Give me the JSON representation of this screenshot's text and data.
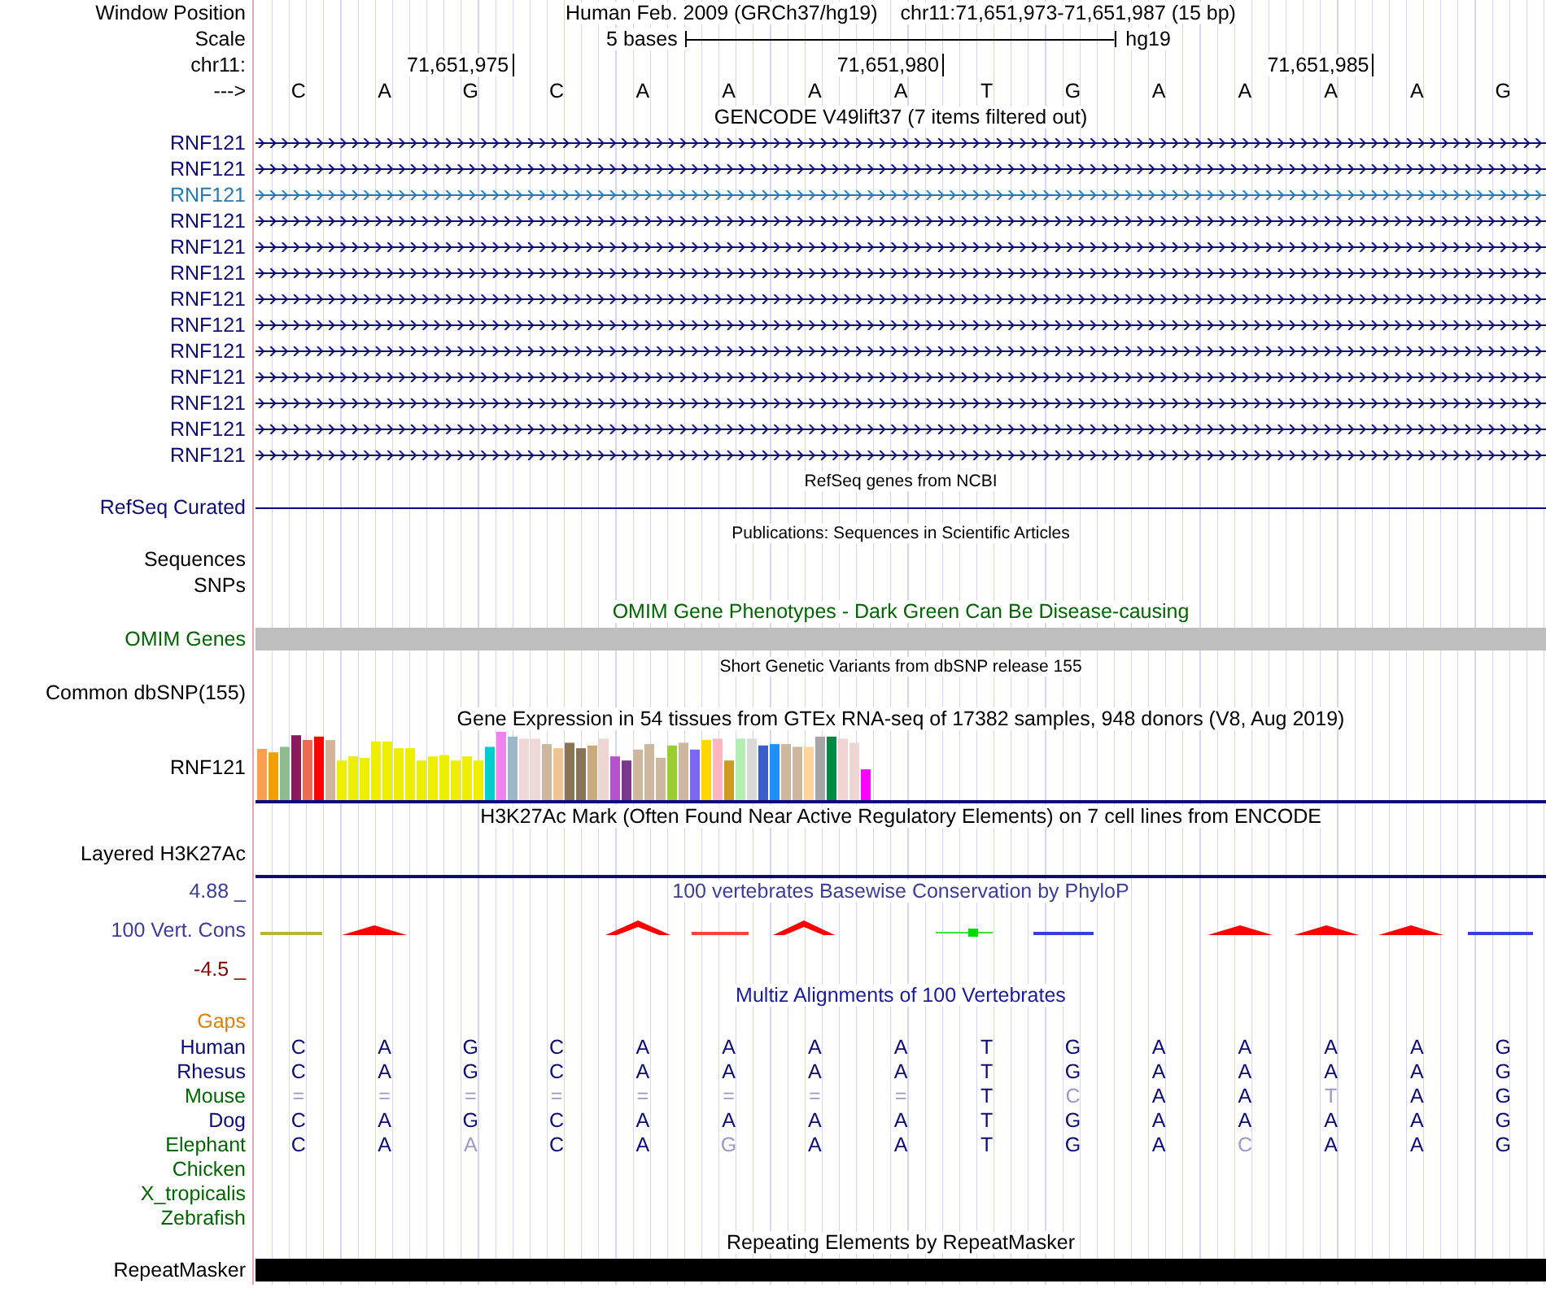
{
  "position": {
    "label": "Window Position",
    "assembly": "Human Feb. 2009 (GRCh37/hg19)",
    "range": "chr11:71,651,973-71,651,987 (15 bp)"
  },
  "scale": {
    "label": "Scale",
    "left": "5 bases",
    "right": "hg19"
  },
  "ruler": {
    "label": "chr11:",
    "ticks": [
      "71,651,975",
      "71,651,980",
      "71,651,985"
    ]
  },
  "bases": {
    "label": "--->",
    "letters": [
      "C",
      "A",
      "G",
      "C",
      "A",
      "A",
      "A",
      "A",
      "T",
      "G",
      "A",
      "A",
      "A",
      "A",
      "G"
    ]
  },
  "tracks": [
    {
      "kind": "genes",
      "title": "GENCODE V49lift37 (7 items filtered out)",
      "color": "#000000",
      "items": [
        {
          "name": "RNF121",
          "color": "#0c0c78"
        },
        {
          "name": "RNF121",
          "color": "#0c0c78"
        },
        {
          "name": "RNF121",
          "color": "#2878b4"
        },
        {
          "name": "RNF121",
          "color": "#0c0c78"
        },
        {
          "name": "RNF121",
          "color": "#0c0c78"
        },
        {
          "name": "RNF121",
          "color": "#0c0c78"
        },
        {
          "name": "RNF121",
          "color": "#0c0c78"
        },
        {
          "name": "RNF121",
          "color": "#0c0c78"
        },
        {
          "name": "RNF121",
          "color": "#0c0c78"
        },
        {
          "name": "RNF121",
          "color": "#0c0c78"
        },
        {
          "name": "RNF121",
          "color": "#0c0c78"
        },
        {
          "name": "RNF121",
          "color": "#0c0c78"
        },
        {
          "name": "RNF121",
          "color": "#0c0c78"
        }
      ]
    },
    {
      "kind": "line",
      "title": "RefSeq genes from NCBI",
      "label": "RefSeq Curated",
      "color": "#0c0c78"
    },
    {
      "kind": "labels",
      "title": "Publications: Sequences in Scientific Articles",
      "labels": [
        "Sequences",
        "SNPs"
      ],
      "color": "#000000"
    },
    {
      "kind": "phenotypes",
      "title": "OMIM Gene Phenotypes - Dark Green Can Be Disease-causing",
      "label": "OMIM Genes",
      "color": "#006400"
    },
    {
      "kind": "labels",
      "title": "Short Genetic Variants from dbSNP release 155",
      "labels": [
        "Common dbSNP(155)"
      ],
      "color": "#000000"
    },
    {
      "kind": "expression",
      "title": "Gene Expression in 54 tissues from GTEx RNA-seq of 17382 samples, 948 donors (V8, Aug 2019)",
      "label": "RNF121",
      "color": "#000000"
    },
    {
      "kind": "signal",
      "title": "H3K27Ac Mark (Often Found Near Active Regulatory Elements) on 7 cell lines from ENCODE",
      "label": "Layered H3K27Ac",
      "color": "#000000"
    },
    {
      "kind": "conservation",
      "title": "100 vertebrates Basewise Conservation by PhyloP",
      "label": "100 Vert. Cons",
      "max": "4.88 _",
      "min": "-4.5 _",
      "color": "#3c3c9a"
    },
    {
      "kind": "alignment",
      "title": "Multiz Alignments of 100 Vertebrates",
      "gaps": "Gaps",
      "color": "#1a1aa0",
      "species": [
        {
          "name": "Human",
          "color": "#0c0c78",
          "cells": [
            {
              "b": "C",
              "faded": false
            },
            {
              "b": "A",
              "faded": false
            },
            {
              "b": "G",
              "faded": false
            },
            {
              "b": "C",
              "faded": false
            },
            {
              "b": "A",
              "faded": false
            },
            {
              "b": "A",
              "faded": false
            },
            {
              "b": "A",
              "faded": false
            },
            {
              "b": "A",
              "faded": false
            },
            {
              "b": "T",
              "faded": false
            },
            {
              "b": "G",
              "faded": false
            },
            {
              "b": "A",
              "faded": false
            },
            {
              "b": "A",
              "faded": false
            },
            {
              "b": "A",
              "faded": false
            },
            {
              "b": "A",
              "faded": false
            },
            {
              "b": "G",
              "faded": false
            }
          ]
        },
        {
          "name": "Rhesus",
          "color": "#0c0c78",
          "cells": [
            {
              "b": "C",
              "faded": false
            },
            {
              "b": "A",
              "faded": false
            },
            {
              "b": "G",
              "faded": false
            },
            {
              "b": "C",
              "faded": false
            },
            {
              "b": "A",
              "faded": false
            },
            {
              "b": "A",
              "faded": false
            },
            {
              "b": "A",
              "faded": false
            },
            {
              "b": "A",
              "faded": false
            },
            {
              "b": "T",
              "faded": false
            },
            {
              "b": "G",
              "faded": false
            },
            {
              "b": "A",
              "faded": false
            },
            {
              "b": "A",
              "faded": false
            },
            {
              "b": "A",
              "faded": false
            },
            {
              "b": "A",
              "faded": false
            },
            {
              "b": "G",
              "faded": false
            }
          ]
        },
        {
          "name": "Mouse",
          "color": "#006400",
          "cells": [
            {
              "b": "=",
              "faded": true
            },
            {
              "b": "=",
              "faded": true
            },
            {
              "b": "=",
              "faded": true
            },
            {
              "b": "=",
              "faded": true
            },
            {
              "b": "=",
              "faded": true
            },
            {
              "b": "=",
              "faded": true
            },
            {
              "b": "=",
              "faded": true
            },
            {
              "b": "=",
              "faded": true
            },
            {
              "b": "T",
              "faded": false
            },
            {
              "b": "C",
              "faded": true
            },
            {
              "b": "A",
              "faded": false
            },
            {
              "b": "A",
              "faded": false
            },
            {
              "b": "T",
              "faded": true
            },
            {
              "b": "A",
              "faded": false
            },
            {
              "b": "G",
              "faded": false
            }
          ]
        },
        {
          "name": "Dog",
          "color": "#0c0c78",
          "cells": [
            {
              "b": "C",
              "faded": false
            },
            {
              "b": "A",
              "faded": false
            },
            {
              "b": "G",
              "faded": false
            },
            {
              "b": "C",
              "faded": false
            },
            {
              "b": "A",
              "faded": false
            },
            {
              "b": "A",
              "faded": false
            },
            {
              "b": "A",
              "faded": false
            },
            {
              "b": "A",
              "faded": false
            },
            {
              "b": "T",
              "faded": false
            },
            {
              "b": "G",
              "faded": false
            },
            {
              "b": "A",
              "faded": false
            },
            {
              "b": "A",
              "faded": false
            },
            {
              "b": "A",
              "faded": false
            },
            {
              "b": "A",
              "faded": false
            },
            {
              "b": "G",
              "faded": false
            }
          ]
        },
        {
          "name": "Elephant",
          "color": "#006400",
          "cells": [
            {
              "b": "C",
              "faded": false
            },
            {
              "b": "A",
              "faded": false
            },
            {
              "b": "A",
              "faded": true
            },
            {
              "b": "C",
              "faded": false
            },
            {
              "b": "A",
              "faded": false
            },
            {
              "b": "G",
              "faded": true
            },
            {
              "b": "A",
              "faded": false
            },
            {
              "b": "A",
              "faded": false
            },
            {
              "b": "T",
              "faded": false
            },
            {
              "b": "G",
              "faded": false
            },
            {
              "b": "A",
              "faded": false
            },
            {
              "b": "C",
              "faded": true
            },
            {
              "b": "A",
              "faded": false
            },
            {
              "b": "A",
              "faded": false
            },
            {
              "b": "G",
              "faded": false
            }
          ]
        },
        {
          "name": "Chicken",
          "color": "#006400"
        },
        {
          "name": "X_tropicalis",
          "color": "#006400"
        },
        {
          "name": "Zebrafish",
          "color": "#006400"
        }
      ]
    },
    {
      "kind": "repeats",
      "title": "Repeating Elements by RepeatMasker",
      "label": "RepeatMasker",
      "color": "#000000"
    }
  ]
}
